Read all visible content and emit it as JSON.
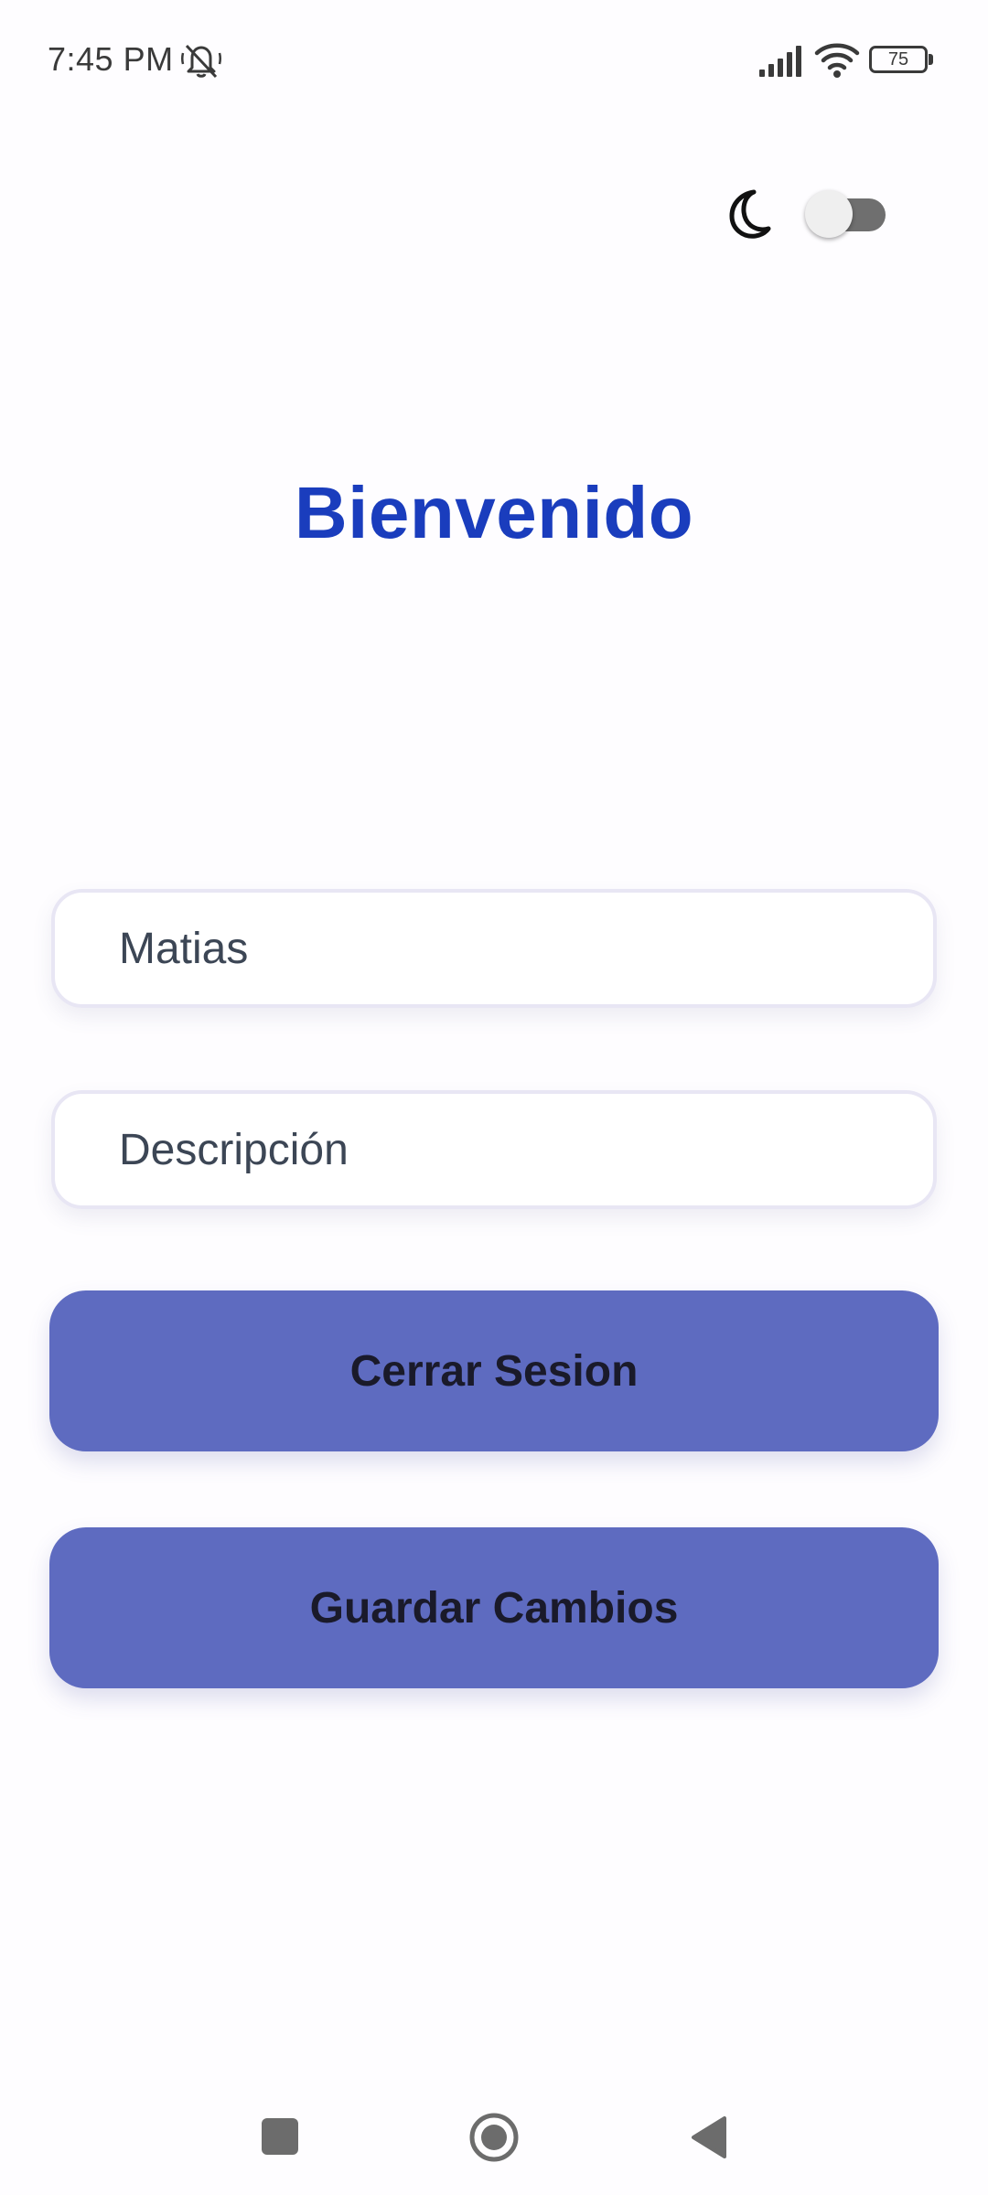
{
  "status_bar": {
    "time": "7:45 PM",
    "muted_icon": "bell-off-icon",
    "signal_icon": "cellular-signal-icon",
    "wifi_icon": "wifi-icon",
    "battery_level": "75"
  },
  "theme_toggle": {
    "icon": "moon-icon",
    "enabled": false
  },
  "title": "Bienvenido",
  "form": {
    "name_value": "Matias",
    "description_placeholder": "Descripción"
  },
  "buttons": {
    "logout_label": "Cerrar Sesion",
    "save_label": "Guardar Cambios"
  },
  "colors": {
    "title": "#1a3dbd",
    "button_bg": "#5e6bc0",
    "button_text": "#1a1a2a",
    "background": "#fefdff"
  },
  "nav_bar": {
    "recents_icon": "square-recents-icon",
    "home_icon": "circle-home-icon",
    "back_icon": "triangle-back-icon"
  }
}
